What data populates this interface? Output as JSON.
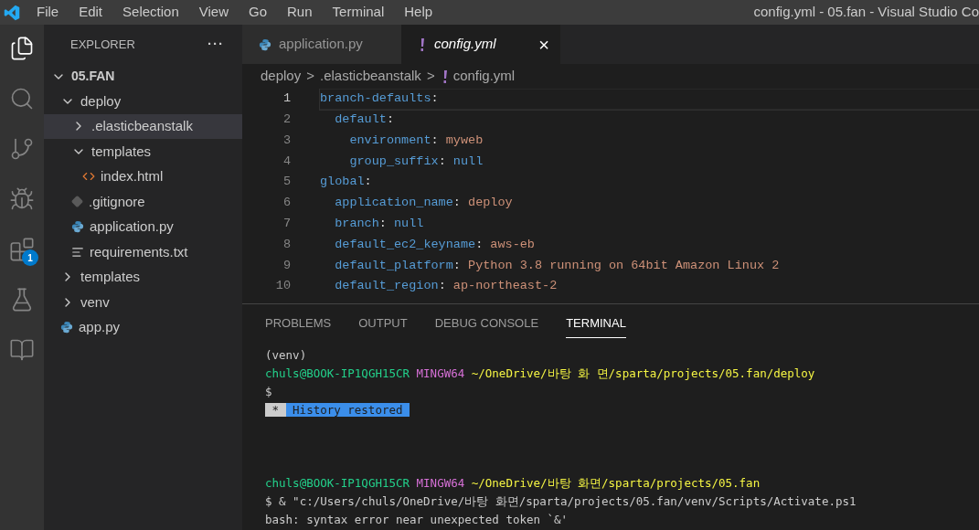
{
  "menu": [
    "File",
    "Edit",
    "Selection",
    "View",
    "Go",
    "Run",
    "Terminal",
    "Help"
  ],
  "window": {
    "title": "config.yml - 05.fan - Visual Studio Co"
  },
  "activity_bar": [
    {
      "kind": "files",
      "selected": true
    },
    {
      "kind": "search",
      "selected": false
    },
    {
      "kind": "source-control",
      "selected": false
    },
    {
      "kind": "debug",
      "selected": false
    },
    {
      "kind": "extensions",
      "selected": false,
      "badge": "1"
    },
    {
      "kind": "testing",
      "selected": false
    },
    {
      "kind": "notebook",
      "selected": false
    }
  ],
  "sidebar": {
    "title": "EXPLORER",
    "more": "···",
    "root": {
      "label": "05.FAN",
      "expanded": true
    },
    "tree": [
      {
        "label": "deploy",
        "kind": "folder",
        "expanded": true,
        "selected": false,
        "children": [
          {
            "label": ".elasticbeanstalk",
            "kind": "folder",
            "expanded": false,
            "selected": true
          },
          {
            "label": "templates",
            "kind": "folder",
            "expanded": true,
            "selected": false,
            "children": [
              {
                "label": "index.html",
                "kind": "html",
                "selected": false
              }
            ]
          },
          {
            "label": ".gitignore",
            "kind": "git",
            "selected": false
          },
          {
            "label": "application.py",
            "kind": "python",
            "selected": false
          },
          {
            "label": "requirements.txt",
            "kind": "text",
            "selected": false
          }
        ]
      },
      {
        "label": "templates",
        "kind": "folder",
        "expanded": false,
        "selected": false
      },
      {
        "label": "venv",
        "kind": "folder",
        "expanded": false,
        "selected": false
      },
      {
        "label": "app.py",
        "kind": "python",
        "selected": false
      }
    ]
  },
  "tabs": [
    {
      "label": "application.py",
      "kind": "python",
      "selected": false,
      "italic": false
    },
    {
      "label": "config.yml",
      "kind": "yaml",
      "selected": true,
      "italic": true,
      "close": "×"
    }
  ],
  "breadcrumb": [
    {
      "label": "deploy",
      "kind": "folder"
    },
    {
      "label": ".elasticbeanstalk",
      "kind": "folder"
    },
    {
      "label": "config.yml",
      "kind": "yaml"
    }
  ],
  "breadcrumb_separator": ">",
  "editor": {
    "lines": [
      {
        "number": "1",
        "current": true,
        "tokens": [
          {
            "kind": "key",
            "text": "branch-defaults"
          },
          {
            "kind": "punct",
            "text": ":"
          }
        ]
      },
      {
        "number": "2",
        "current": false,
        "tokens": [
          {
            "kind": "key",
            "text": "  default"
          },
          {
            "kind": "punct",
            "text": ":"
          }
        ]
      },
      {
        "number": "3",
        "current": false,
        "tokens": [
          {
            "kind": "key",
            "text": "    environment"
          },
          {
            "kind": "punct",
            "text": ": "
          },
          {
            "kind": "string",
            "text": "myweb"
          }
        ]
      },
      {
        "number": "4",
        "current": false,
        "tokens": [
          {
            "kind": "key",
            "text": "    group_suffix"
          },
          {
            "kind": "punct",
            "text": ": "
          },
          {
            "kind": "null",
            "text": "null"
          }
        ]
      },
      {
        "number": "5",
        "current": false,
        "tokens": [
          {
            "kind": "key",
            "text": "global"
          },
          {
            "kind": "punct",
            "text": ":"
          }
        ]
      },
      {
        "number": "6",
        "current": false,
        "tokens": [
          {
            "kind": "key",
            "text": "  application_name"
          },
          {
            "kind": "punct",
            "text": ": "
          },
          {
            "kind": "string",
            "text": "deploy"
          }
        ]
      },
      {
        "number": "7",
        "current": false,
        "tokens": [
          {
            "kind": "key",
            "text": "  branch"
          },
          {
            "kind": "punct",
            "text": ": "
          },
          {
            "kind": "null",
            "text": "null"
          }
        ]
      },
      {
        "number": "8",
        "current": false,
        "tokens": [
          {
            "kind": "key",
            "text": "  default_ec2_keyname"
          },
          {
            "kind": "punct",
            "text": ": "
          },
          {
            "kind": "string",
            "text": "aws-eb"
          }
        ]
      },
      {
        "number": "9",
        "current": false,
        "tokens": [
          {
            "kind": "key",
            "text": "  default_platform"
          },
          {
            "kind": "punct",
            "text": ": "
          },
          {
            "kind": "string",
            "text": "Python 3.8 running on 64bit Amazon Linux 2"
          }
        ]
      },
      {
        "number": "10",
        "current": false,
        "tokens": [
          {
            "kind": "key",
            "text": "  default_region"
          },
          {
            "kind": "punct",
            "text": ": "
          },
          {
            "kind": "string",
            "text": "ap-northeast-2"
          }
        ]
      }
    ]
  },
  "panel": {
    "tabs": [
      {
        "label": "PROBLEMS",
        "selected": false
      },
      {
        "label": "OUTPUT",
        "selected": false
      },
      {
        "label": "DEBUG CONSOLE",
        "selected": false
      },
      {
        "label": "TERMINAL",
        "selected": true
      }
    ],
    "terminal": [
      {
        "lines": [
          [
            {
              "kind": "plain",
              "text": "(venv)"
            }
          ],
          [
            {
              "kind": "user",
              "text": "chuls@BOOK-IP1QGH15CR"
            },
            {
              "kind": "host",
              "text": "MINGW64"
            },
            {
              "kind": "path",
              "text": "~/OneDrive/바탕 화 면/sparta/projects/05.fan/deploy"
            }
          ],
          [
            {
              "kind": "plain",
              "text": "$"
            }
          ],
          [
            {
              "kind": "badge",
              "text": "*"
            },
            {
              "kind": "highlight",
              "text": "History restored"
            }
          ]
        ]
      },
      {
        "lines": [
          [
            {
              "kind": "user",
              "text": "chuls@BOOK-IP1QGH15CR"
            },
            {
              "kind": "host",
              "text": "MINGW64"
            },
            {
              "kind": "path",
              "text": "~/OneDrive/바탕 화면/sparta/projects/05.fan"
            }
          ],
          [
            {
              "kind": "plain",
              "text": "$ & \"c:/Users/chuls/OneDrive/바탕 화면/sparta/projects/05.fan/venv/Scripts/Activate.ps1"
            }
          ],
          [
            {
              "kind": "plain",
              "text": "bash: syntax error near unexpected token `&'"
            }
          ]
        ]
      }
    ]
  }
}
